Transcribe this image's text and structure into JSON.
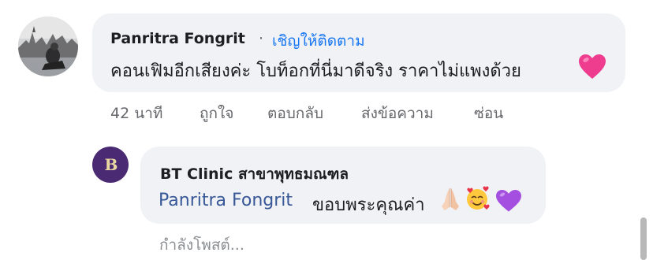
{
  "comment": {
    "author": "Panritra Fongrit",
    "separator": "·",
    "follow_label": "เชิญให้ติดตาม",
    "text": "คอนเฟิมอีกเสียงค่ะ โบท็อกที่นี่มาดีจริง ราคาไม่แพงด้วย",
    "emoji": "pink-heart",
    "time": "42 นาที",
    "actions": {
      "like": "ถูกใจ",
      "reply": "ตอบกลับ",
      "share": "ส่งข้อความ",
      "hide": "ซ่อน"
    }
  },
  "reply": {
    "author": "BT Clinic สาขาพุทธมณฑล",
    "avatar_text": "B",
    "mention": "Panritra Fongrit",
    "text": "ขอบพระคุณค่า",
    "emojis": [
      "folded-hands",
      "smiling-face-with-hearts",
      "purple-heart"
    ]
  },
  "status": {
    "posting": "กำลังโพสต์..."
  },
  "colors": {
    "bubble": "#f0f2f5",
    "link": "#1877f2",
    "mention": "#385898",
    "secondary_text": "#65676b",
    "brand_avatar": "#4a2a73"
  }
}
